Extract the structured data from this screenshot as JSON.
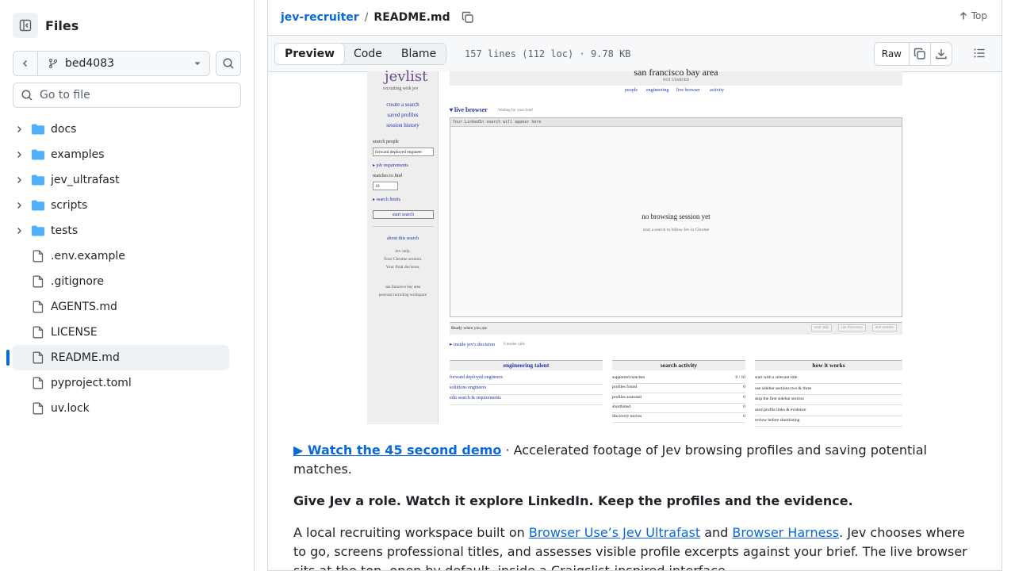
{
  "sidebar": {
    "title": "Files",
    "branch": "bed4083",
    "search_placeholder": "Go to file",
    "tree": [
      {
        "name": "docs",
        "type": "folder"
      },
      {
        "name": "examples",
        "type": "folder"
      },
      {
        "name": "jev_ultrafast",
        "type": "folder"
      },
      {
        "name": "scripts",
        "type": "folder"
      },
      {
        "name": "tests",
        "type": "folder"
      },
      {
        "name": ".env.example",
        "type": "file"
      },
      {
        "name": ".gitignore",
        "type": "file"
      },
      {
        "name": "AGENTS.md",
        "type": "file"
      },
      {
        "name": "LICENSE",
        "type": "file"
      },
      {
        "name": "README.md",
        "type": "file",
        "active": true
      },
      {
        "name": "pyproject.toml",
        "type": "file"
      },
      {
        "name": "uv.lock",
        "type": "file"
      }
    ]
  },
  "header": {
    "repo": "jev-recruiter",
    "separator": "/",
    "file": "README.md",
    "top_label": "Top"
  },
  "toolbar": {
    "tabs": [
      "Preview",
      "Code",
      "Blame"
    ],
    "active_tab": "Preview",
    "meta": "157 lines (112 loc) · 9.78 KB",
    "raw_label": "Raw"
  },
  "embedded": {
    "brand": "jevlist",
    "brand_sub": "recruiting with jev",
    "region": "san francisco bay area",
    "status": "NOT STARTED",
    "top_nav": [
      "people",
      "engineering",
      "live browser",
      "activity"
    ],
    "nav": [
      "create a search",
      "saved profiles",
      "session history"
    ],
    "search_label": "search people",
    "search_value": "forward deployed engineer",
    "job_req": "▸ job requirements",
    "matches_label": "matches to find",
    "matches_value": "10",
    "search_limits": "▸ search limits",
    "start_button": "start search",
    "about": "about this search",
    "about_lines": [
      "Jev only.",
      "Your Chrome session.",
      "Your final decision."
    ],
    "footer_lines": [
      "san francisco bay area",
      "personal recruiting workspace"
    ],
    "live_browser": "▾ live browser",
    "waiting": "Waiting for your brief",
    "url_bar": "Your LinkedIn search will appear here",
    "no_session": "no browsing session yet",
    "no_session_sub": "start a search to follow Jev in Chrome",
    "ready": "Ready when you are",
    "ctrl_buttons": [
      "next step",
      "run discovery",
      "end session"
    ],
    "inside": "▸ inside jev's decision",
    "inside_sub": "0 model calls",
    "col1_title": "engineering talent",
    "col1_items": [
      "forward deployed engineers",
      "solutions engineers",
      "edit search & requirements"
    ],
    "col2_title": "search activity",
    "col2_rows": [
      {
        "k": "supported matches",
        "v": "0 / 10"
      },
      {
        "k": "profiles found",
        "v": "0"
      },
      {
        "k": "profiles assessed",
        "v": "0"
      },
      {
        "k": "shortlisted",
        "v": "0"
      },
      {
        "k": "discovery moves",
        "v": "0"
      }
    ],
    "col3_title": "how it works",
    "col3_items": [
      "start with a relevant title",
      "use sidebar sections two & three",
      "skip the first sidebar section",
      "save profile links & evidence",
      "review before shortlisting"
    ]
  },
  "readme": {
    "demo_link": "▶ Watch the 45 second demo",
    "demo_rest": " · Accelerated footage of Jev browsing profiles and saving potential matches.",
    "tagline": "Give Jev a role. Watch it explore LinkedIn. Keep the profiles and the evidence.",
    "p1_a": "A local recruiting workspace built on ",
    "p1_link1": "Browser Use’s Jev Ultrafast",
    "p1_b": " and ",
    "p1_link2": "Browser Harness",
    "p1_c": ". Jev chooses where to go, screens professional titles, and assesses visible profile excerpts against your brief. The live browser sits at the top, open by default, inside a Craigslist-inspired interface."
  },
  "colors": {
    "accent": "#0969da",
    "folder": "#54aeff",
    "active_bar": "#0969da"
  }
}
